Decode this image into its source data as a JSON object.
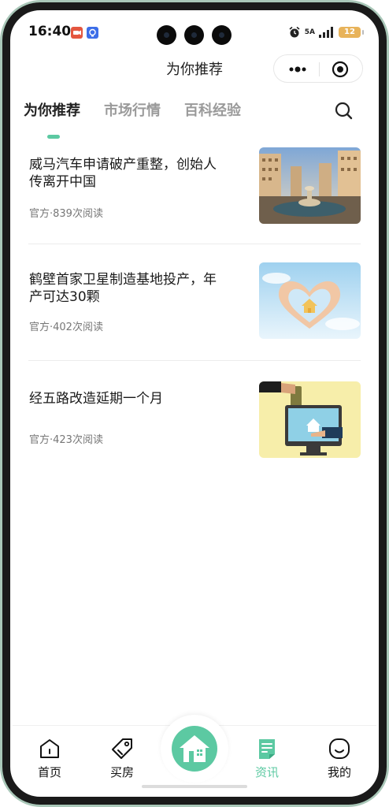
{
  "status_bar": {
    "time": "16:40",
    "network": "5A",
    "battery": "12"
  },
  "header": {
    "title": "为你推荐"
  },
  "tabs": [
    {
      "label": "为你推荐",
      "active": true
    },
    {
      "label": "市场行情",
      "active": false
    },
    {
      "label": "百科经验",
      "active": false
    }
  ],
  "articles": [
    {
      "title": "威马汽车申请破产重整，创始人传离开中国",
      "meta": "官方·839次阅读",
      "image": "luxury-estate-fountain-photo"
    },
    {
      "title": "鹤壁首家卫星制造基地投产，年产可达30颗",
      "meta": "官方·402次阅读",
      "image": "hands-heart-house-photo"
    },
    {
      "title": "经五路改造延期一个月",
      "meta": "官方·423次阅读",
      "image": "online-property-payment-illustration"
    }
  ],
  "tabbar": {
    "items": [
      {
        "label": "首页",
        "icon": "home-outline-icon"
      },
      {
        "label": "买房",
        "icon": "tag-icon"
      },
      {
        "label": "资讯",
        "icon": "news-document-icon",
        "active": true
      },
      {
        "label": "我的",
        "icon": "smile-face-icon"
      }
    ],
    "center_icon": "house-fab-icon"
  },
  "colors": {
    "accent": "#5cc9a2",
    "text_primary": "#1a1a1a",
    "text_muted": "#777777",
    "tab_inactive": "#9a9a9a"
  }
}
